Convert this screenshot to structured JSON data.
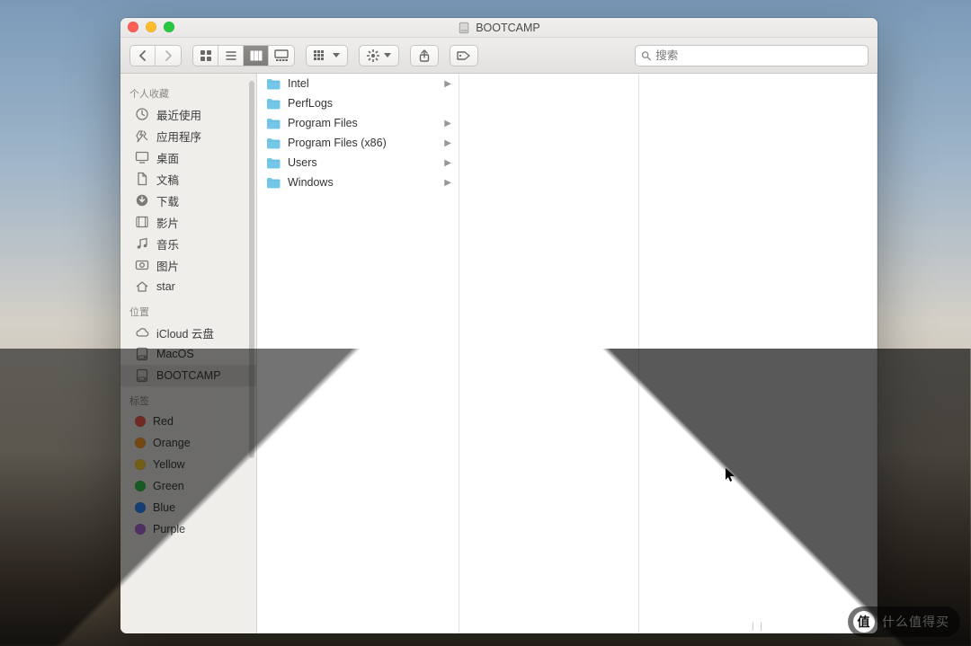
{
  "window": {
    "title": "BOOTCAMP"
  },
  "search": {
    "placeholder": "搜索"
  },
  "sidebar": {
    "sections": [
      {
        "title": "个人收藏",
        "items": [
          {
            "icon": "clock-icon",
            "label": "最近使用"
          },
          {
            "icon": "apps-icon",
            "label": "应用程序"
          },
          {
            "icon": "desktop-icon",
            "label": "桌面"
          },
          {
            "icon": "doc-icon",
            "label": "文稿"
          },
          {
            "icon": "download-icon",
            "label": "下载"
          },
          {
            "icon": "movie-icon",
            "label": "影片"
          },
          {
            "icon": "music-icon",
            "label": "音乐"
          },
          {
            "icon": "photo-icon",
            "label": "图片"
          },
          {
            "icon": "home-icon",
            "label": "star"
          }
        ]
      },
      {
        "title": "位置",
        "items": [
          {
            "icon": "cloud-icon",
            "label": "iCloud 云盘"
          },
          {
            "icon": "disk-icon",
            "label": "MacOS"
          },
          {
            "icon": "disk-icon",
            "label": "BOOTCAMP",
            "selected": true
          }
        ]
      },
      {
        "title": "标签",
        "items": [
          {
            "tagColor": "#ff5a4e",
            "label": "Red"
          },
          {
            "tagColor": "#ff9f2e",
            "label": "Orange"
          },
          {
            "tagColor": "#ffd02e",
            "label": "Yellow"
          },
          {
            "tagColor": "#34c749",
            "label": "Green"
          },
          {
            "tagColor": "#2e8cff",
            "label": "Blue"
          },
          {
            "tagColor": "#b06bd6",
            "label": "Purple"
          }
        ]
      }
    ]
  },
  "files": [
    {
      "name": "Intel",
      "hasChildren": true
    },
    {
      "name": "PerfLogs",
      "hasChildren": false
    },
    {
      "name": "Program Files",
      "hasChildren": true
    },
    {
      "name": "Program Files (x86)",
      "hasChildren": true
    },
    {
      "name": "Users",
      "hasChildren": true
    },
    {
      "name": "Windows",
      "hasChildren": true
    }
  ],
  "watermark": {
    "badge": "值",
    "text": "什么值得买"
  }
}
